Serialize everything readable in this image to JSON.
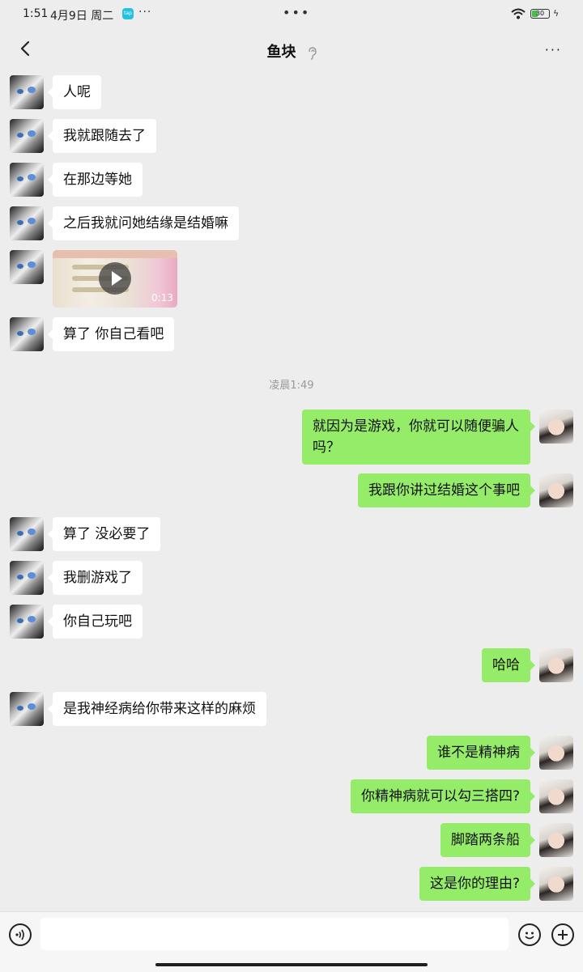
{
  "status_bar": {
    "time": "1:51",
    "date": "4月9日 周二",
    "app_badge": "tap",
    "more": "···",
    "center_dots": "•••",
    "battery": "30"
  },
  "nav": {
    "title": "鱼块",
    "back_icon": "chevron-left-icon",
    "more": "···"
  },
  "timestamp": "凌晨1:49",
  "video": {
    "duration": "0:13"
  },
  "messages": {
    "m1": "人呢",
    "m2": "我就跟随去了",
    "m3": "在那边等她",
    "m4": "之后我就问她结缘是结婚嘛",
    "m6": "算了 你自己看吧",
    "m7": "就因为是游戏，你就可以随便骗人吗？",
    "m8": "我跟你讲过结婚这个事吧",
    "m9": "算了 没必要了",
    "m10": "我删游戏了",
    "m11": "你自己玩吧",
    "m12": "哈哈",
    "m13": "是我神经病给你带来这样的麻烦",
    "m14": "谁不是精神病",
    "m15": "你精神病就可以勾三搭四?",
    "m16": "脚踏两条船",
    "m17": "这是你的理由?"
  },
  "input": {
    "placeholder": "",
    "value": ""
  },
  "colors": {
    "outgoing_bubble": "#95ec69",
    "incoming_bubble": "#ffffff",
    "background": "#ededed"
  }
}
